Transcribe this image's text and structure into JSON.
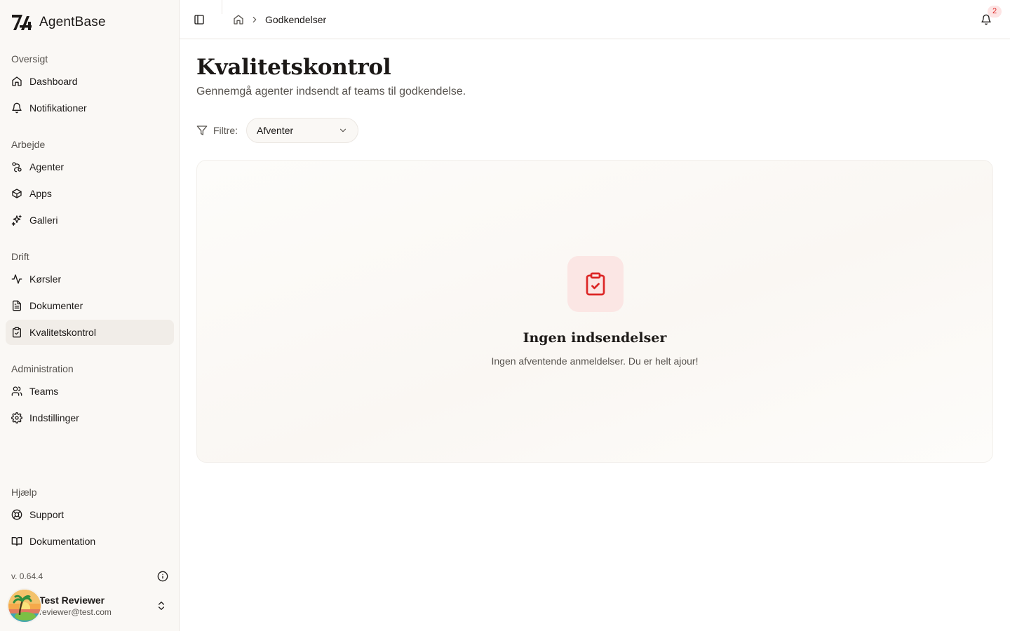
{
  "brand": {
    "name": "AgentBase"
  },
  "sidebar": {
    "sections": [
      {
        "heading": "Oversigt",
        "items": [
          {
            "label": "Dashboard",
            "icon": "home-icon"
          },
          {
            "label": "Notifikationer",
            "icon": "bell-icon"
          }
        ]
      },
      {
        "heading": "Arbejde",
        "items": [
          {
            "label": "Agenter",
            "icon": "route-icon"
          },
          {
            "label": "Apps",
            "icon": "box-icon"
          },
          {
            "label": "Galleri",
            "icon": "sparkles-icon"
          }
        ]
      },
      {
        "heading": "Drift",
        "items": [
          {
            "label": "Kørsler",
            "icon": "activity-icon"
          },
          {
            "label": "Dokumenter",
            "icon": "file-text-icon"
          },
          {
            "label": "Kvalitetskontrol",
            "icon": "clipboard-check-icon",
            "active": true
          }
        ]
      },
      {
        "heading": "Administration",
        "items": [
          {
            "label": "Teams",
            "icon": "users-icon"
          },
          {
            "label": "Indstillinger",
            "icon": "gear-icon"
          }
        ]
      },
      {
        "heading": "Hjælp",
        "items": [
          {
            "label": "Support",
            "icon": "life-buoy-icon"
          },
          {
            "label": "Dokumentation",
            "icon": "book-open-icon"
          }
        ]
      }
    ],
    "version": "v. 0.64.4",
    "user": {
      "name": "Test Reviewer",
      "email": "reviewer@test.com"
    }
  },
  "topbar": {
    "breadcrumb_current": "Godkendelser",
    "notification_count": "2"
  },
  "page": {
    "title": "Kvalitetskontrol",
    "subtitle": "Gennemgå agenter indsendt af teams til godkendelse.",
    "filter_label": "Filtre:",
    "filter_value": "Afventer",
    "empty_title": "Ingen indsendelser",
    "empty_desc": "Ingen afventende anmeldelser. Du er helt ajour!"
  },
  "colors": {
    "accent": "#dc2626",
    "accent_soft": "#fbe6e4",
    "sidebar_bg": "#faf8f5",
    "active_bg": "#f1ede8"
  }
}
